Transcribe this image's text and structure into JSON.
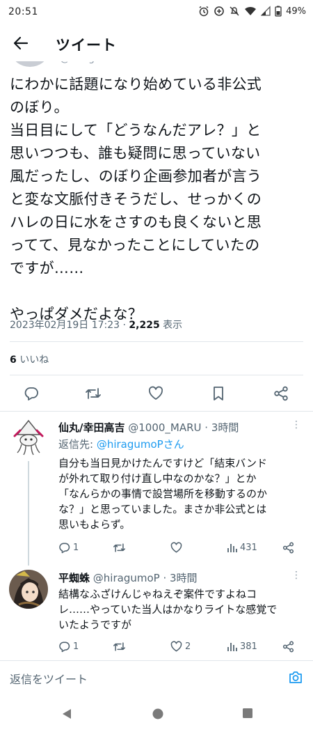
{
  "status_bar": {
    "time": "20:51",
    "battery": "49%"
  },
  "header": {
    "title": "ツイート",
    "back_icon": "arrow-left-icon"
  },
  "main_tweet": {
    "handle_partial": "@hiragumoP",
    "body": "にわかに話題になり始めている非公式\nのぼり。\n当日目にして「どうなんだアレ？」と\n思いつつも、誰も疑問に思っていない\n風だったし、のぼり企画参加者が言う\nと変な文脈付きそうだし、せっかくの\nハレの日に水をさすのも良くないと思\nってて、見なかったことにしていたの\nですが……\n\nやっぱダメだよな？",
    "timestamp": "2023年02月19日 17:23",
    "separator": " · ",
    "views_count": "2,225",
    "views_label": " 表示",
    "likes_count": "6",
    "likes_label": " いいね"
  },
  "actions": [
    "reply-icon",
    "retweet-icon",
    "like-icon",
    "bookmark-icon",
    "share-icon"
  ],
  "replies": [
    {
      "name": "仙丸/幸田高吉",
      "handle": " @1000_MARU",
      "time": " · 3時間",
      "replying_to_label": "返信先: ",
      "replying_to_handle": "@hiragumoPさん",
      "text": "自分も当日見かけたんですけど「結束バンド\nが外れて取り付け直し中なのかな？」とか\n「なんらかの事情で設営場所を移動するのか\nな？」と思っていました。まさか非公式とは\n思いもよらず。",
      "reply_count": "1",
      "retweet_count": "",
      "like_count": "",
      "view_count": "431"
    },
    {
      "name": "平蜘蛛",
      "handle": " @hiragumoP",
      "time": " · 3時間",
      "text": "結構なふざけんじゃねえぞ案件ですよねコ\nレ……やっていた当人はかなりライトな感覚で\nいたようですが",
      "reply_count": "1",
      "retweet_count": "",
      "like_count": "2",
      "view_count": "381"
    }
  ],
  "composer": {
    "placeholder": "返信をツイート"
  },
  "colors": {
    "accent": "#1d9bf0",
    "text": "#0f1419",
    "secondary": "#536471"
  }
}
